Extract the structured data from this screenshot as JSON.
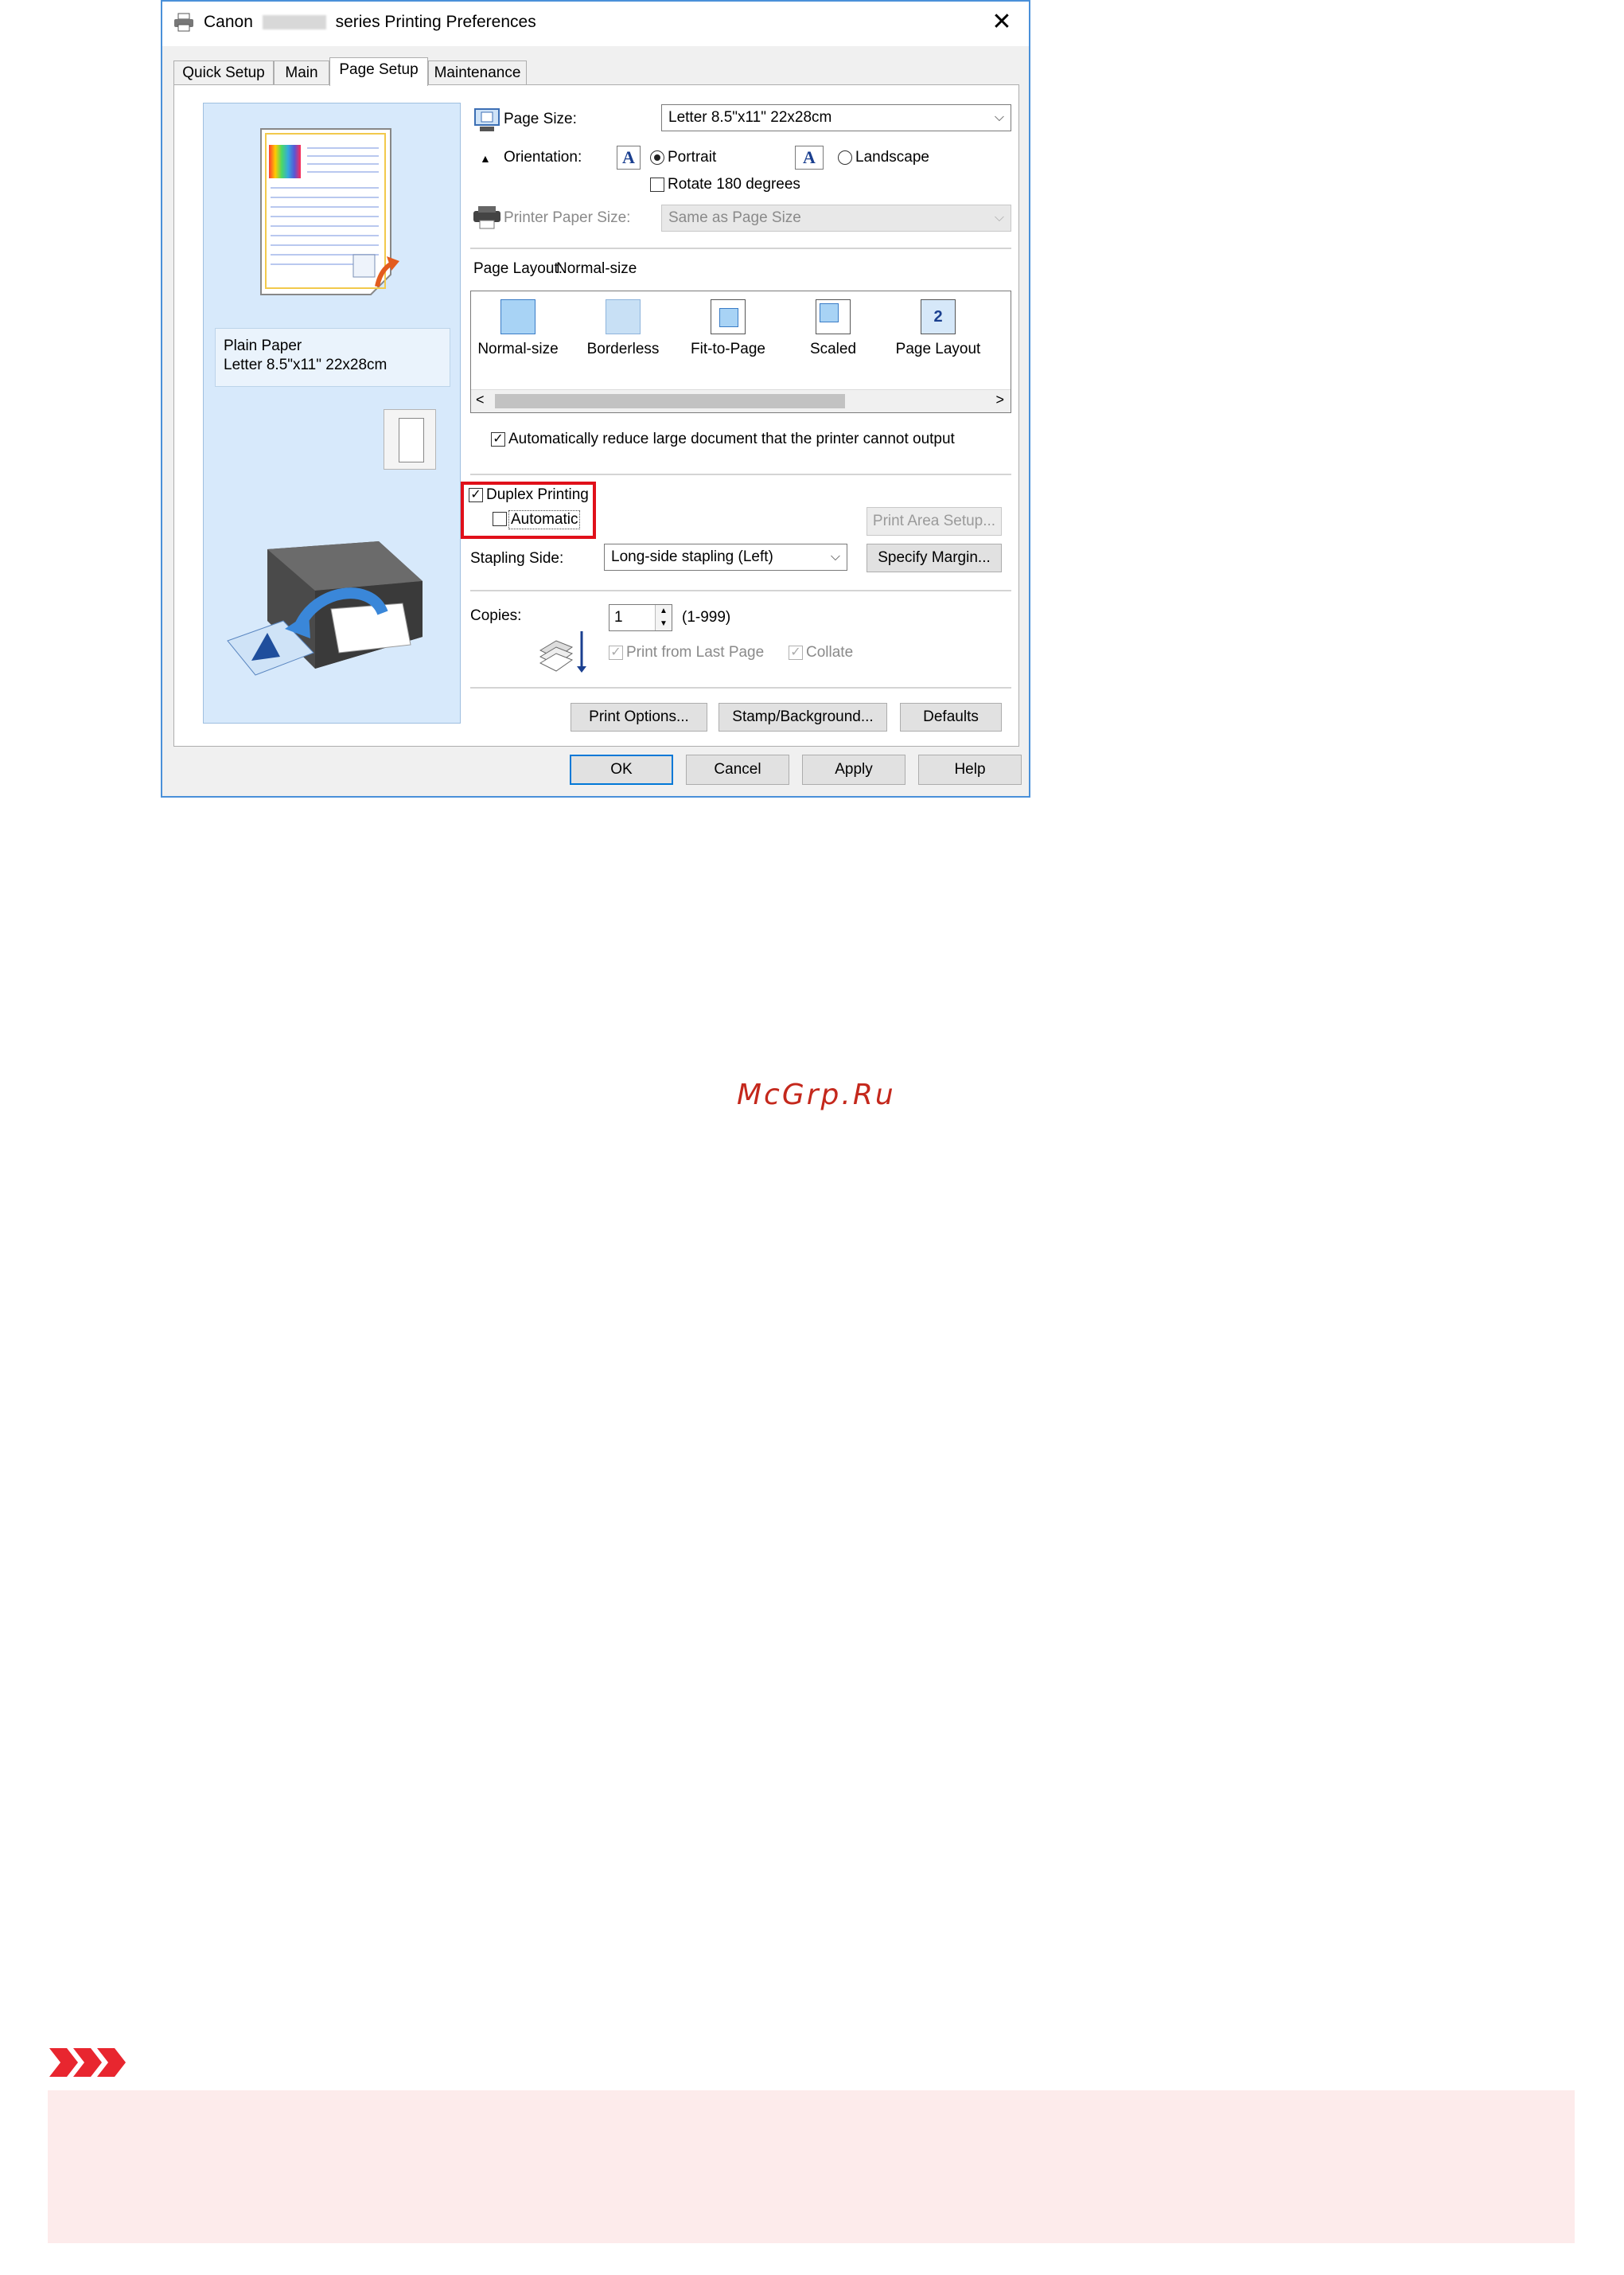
{
  "window": {
    "title_prefix": "Canon",
    "title_suffix": "series Printing Preferences",
    "close_glyph": "✕"
  },
  "tabs": [
    {
      "label": "Quick Setup"
    },
    {
      "label": "Main"
    },
    {
      "label": "Page Setup",
      "active": true
    },
    {
      "label": "Maintenance"
    }
  ],
  "preview": {
    "media_type": "Plain Paper",
    "paper_size": "Letter 8.5\"x11\" 22x28cm"
  },
  "page_size": {
    "label": "Page Size:",
    "value": "Letter 8.5\"x11\" 22x28cm"
  },
  "orientation": {
    "label": "Orientation:",
    "portrait": "Portrait",
    "landscape": "Landscape",
    "selected": "Portrait",
    "rotate_label": "Rotate 180 degrees",
    "icon_letter": "A"
  },
  "printer_paper_size": {
    "label": "Printer Paper Size:",
    "value": "Same as Page Size"
  },
  "page_layout": {
    "label": "Page Layout:",
    "current": "Normal-size",
    "items": [
      {
        "label": "Normal-size",
        "icon": "normal-size-icon"
      },
      {
        "label": "Borderless",
        "icon": "borderless-icon"
      },
      {
        "label": "Fit-to-Page",
        "icon": "fit-to-page-icon"
      },
      {
        "label": "Scaled",
        "icon": "scaled-icon"
      },
      {
        "label": "Page Layout",
        "icon": "page-layout-icon",
        "glyph": "2"
      }
    ],
    "scroll_left": "<",
    "scroll_right": ">"
  },
  "auto_reduce": {
    "label": "Automatically reduce large document that the printer cannot output",
    "checked": true
  },
  "duplex": {
    "label": "Duplex Printing",
    "checked": true,
    "automatic_label": "Automatic",
    "automatic_checked": false
  },
  "print_area_setup": "Print Area Setup...",
  "stapling": {
    "label": "Stapling Side:",
    "value": "Long-side stapling (Left)"
  },
  "specify_margin": "Specify Margin...",
  "copies": {
    "label": "Copies:",
    "value": "1",
    "range": "(1-999)",
    "print_from_last": "Print from Last Page",
    "collate": "Collate"
  },
  "bottom_buttons": {
    "print_options": "Print Options...",
    "stamp": "Stamp/Background...",
    "defaults": "Defaults"
  },
  "dialog_buttons": {
    "ok": "OK",
    "cancel": "Cancel",
    "apply": "Apply",
    "help": "Help"
  },
  "watermark": "McGrp.Ru",
  "colors": {
    "highlight_red": "#e0101a",
    "important_bg": "#fdebeb",
    "important_icon": "#e8262f",
    "window_border": "#4a90d9",
    "watermark": "#c4281c"
  }
}
